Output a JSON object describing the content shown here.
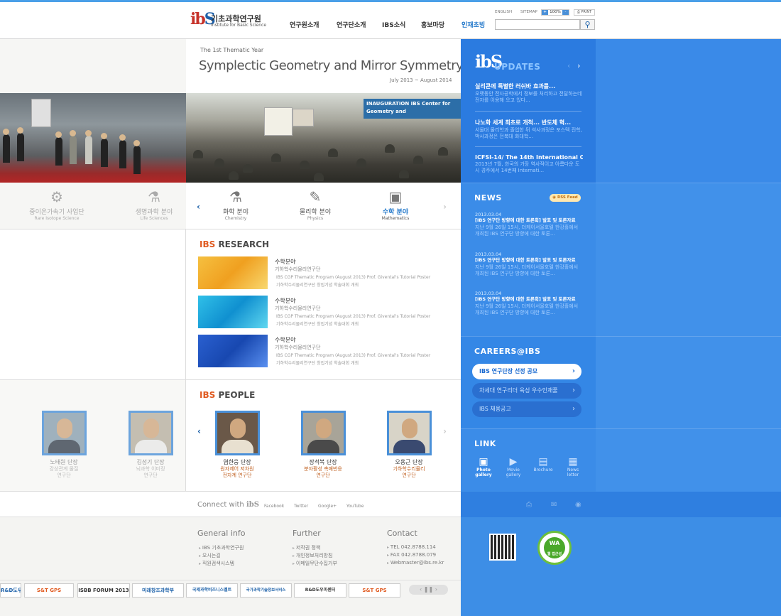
{
  "header": {
    "logo_mark_a": "ib",
    "logo_mark_b": "S",
    "logo_ko": "기초과학연구원",
    "logo_en": "Institute for Basic Science",
    "nav": [
      "연구원소개",
      "연구단소개",
      "IBS소식",
      "홍보마당",
      "인재초빙"
    ],
    "util_english": "ENGLISH",
    "util_sitemap": "SITEMAP",
    "zoom_minus": "+",
    "zoom_value": "100%",
    "zoom_plus": "-",
    "print": "PRINT",
    "search_placeholder": "",
    "search_icon": "search-icon"
  },
  "thematic": {
    "label": "The 1st Thematic Year",
    "title": "Symplectic Geometry and Mirror Symmetry.",
    "dates": "July 2013 ~ August 2014",
    "photo_banner": "INAUGURATION IBS Center for Geometry and"
  },
  "fields": [
    {
      "ko": "중이온가속기 사업단",
      "en": "Rare Isotope Science",
      "icon": "accelerator-icon"
    },
    {
      "ko": "생명과학 분야",
      "en": "Life Sciences",
      "icon": "microscope-icon"
    },
    {
      "ko": "화학 분야",
      "en": "Chemistry",
      "icon": "flask-icon"
    },
    {
      "ko": "물리학 분야",
      "en": "Physics",
      "icon": "physics-icon"
    },
    {
      "ko": "수학 분야",
      "en": "Mathematics",
      "icon": "math-icon"
    }
  ],
  "research": {
    "title_red": "IBS",
    "title_rest": " RESEARCH",
    "items": [
      {
        "cat": "수학분야",
        "sub": "기하학수리물리연구단",
        "l1": "IBS CGP Thematic Program (August 2013) Prof. Givental's Tutorial Poster",
        "l2": "기하학수리물리연구단 창립기념 학술대회 개최"
      },
      {
        "cat": "수학분야",
        "sub": "기하학수리물리연구단",
        "l1": "IBS CGP Thematic Program (August 2013) Prof. Givental's Tutorial Poster",
        "l2": "기하학수리물리연구단 창립기념 학술대회 개최"
      },
      {
        "cat": "수학분야",
        "sub": "기하학수리물리연구단",
        "l1": "IBS CGP Thematic Program (August 2013) Prof. Givental's Tutorial Poster",
        "l2": "기하학수리물리연구단 창립기념 학술대회 개최"
      }
    ]
  },
  "people": {
    "title_red": "IBS",
    "title_rest": " PEOPLE",
    "items": [
      {
        "name": "노태원 단장",
        "d1": "강상관계 물질",
        "d2": "연구단"
      },
      {
        "name": "김성기 단장",
        "d1": "뇌과학 이미징",
        "d2": "연구단"
      },
      {
        "name": "염한웅 단장",
        "d1": "원자제어 저차원",
        "d2": "전자계 연구단"
      },
      {
        "name": "장석복 단장",
        "d1": "분자활성 촉매반응",
        "d2": "연구단"
      },
      {
        "name": "오용근 단장",
        "d1": "기하학수리물리",
        "d2": "연구단"
      }
    ]
  },
  "connect": {
    "label": "Connect with",
    "mark": "ibS",
    "links": [
      "Facebook",
      "Twitter",
      "Google+",
      "YouTube"
    ]
  },
  "footer": {
    "general_title": "General info",
    "general": [
      "IBS 기초과학연구원",
      "오시는길",
      "직원검색시스템"
    ],
    "further_title": "Further",
    "further": [
      "저작권 정책",
      "개인정보처리방침",
      "이메일무단수집거부"
    ],
    "contact_title": "Contact",
    "contact": [
      "TEL 042.8788.114",
      "FAX 042.8788.079",
      "Webmaster@ibs.re.kr"
    ],
    "banners": [
      "R&D도우미센터",
      "S&T GPS",
      "ISBB FORUM 2013",
      "미래창조과학부",
      "국제과학비즈니스벨트",
      "국가과학기술정보서비스",
      "R&D도우미센터",
      "S&T GPS"
    ],
    "banner_nav": "‹ ❚❚ ›"
  },
  "updates": {
    "logo": "ibS",
    "title": "UPDATES",
    "items": [
      {
        "t": "실리콘에 특별한 러쉬바 효과를...",
        "d": "오랫동안 전자공학에서 정보를 처리하고 전달하는데 전자를 이용해 오고 있다..."
      },
      {
        "t": "나노화 세계 최초로 개척... 반도체 혁...",
        "d": "서울대 물리학과 졸업한 뒤 석사과정은 포스텍 진학, 박사과정은 전북대 화대학..."
      },
      {
        "t": "ICFSI-14/ The 14th International Co...",
        "d": "2013년 7월, 한국의 가장 역사적이고 아름다운 도시 경주에서 14번째 Internati..."
      }
    ]
  },
  "news": {
    "title": "NEWS",
    "rss": "RSS Feed",
    "items": [
      {
        "date": "2013.03.04",
        "title": "[IBS 연구단 방향에 대한 토론회] 발표 및 토론자료",
        "desc": "지난 9월 26일 15시, 더케이서울호텔 한강홀에서 개최된 IBS 연구단 방향에 대한 토론..."
      },
      {
        "date": "2013.03.04",
        "title": "[IBS 연구단 방향에 대한 토론회] 발표 및 토론자료",
        "desc": "지난 9월 26일 15시, 더케이서울호텔 한강홀에서 개최된 IBS 연구단 방향에 대한 토론..."
      },
      {
        "date": "2013.03.04",
        "title": "[IBS 연구단 방향에 대한 토론회] 발표 및 토론자료",
        "desc": "지난 9월 26일 15시, 더케이서울호텔 한강홀에서 개최된 IBS 연구단 방향에 대한 토론..."
      }
    ]
  },
  "careers": {
    "title": "CAREERS@IBS",
    "items": [
      "IBS 연구단장 선정 공모",
      "차세대 연구리더 육성 우수인재풀",
      "IBS 채용공고"
    ]
  },
  "link": {
    "title": "LINK",
    "items": [
      {
        "l1": "Photo",
        "l2": "gallery",
        "icon": "photo-icon"
      },
      {
        "l1": "Movie",
        "l2": "gallery",
        "icon": "movie-icon"
      },
      {
        "l1": "Brochure",
        "l2": "",
        "icon": "brochure-icon"
      },
      {
        "l1": "News",
        "l2": "letter",
        "icon": "newsletter-icon"
      }
    ]
  },
  "badges": {
    "wa_text": "WA",
    "wa_sub": "웹 접근성"
  },
  "colors": {
    "brand_red": "#c6322a",
    "brand_blue": "#1d5fa8",
    "accent_orange": "#e05a20",
    "panel_blue": "#3d8ee6"
  }
}
